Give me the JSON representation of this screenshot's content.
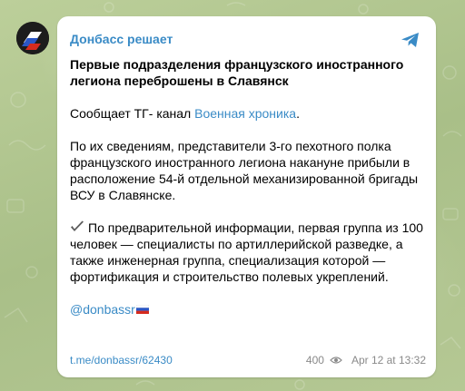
{
  "channel": {
    "name": "Донбасс решает"
  },
  "post": {
    "headline": "Первые подразделения французского иностранного легиона переброшены в Славянск",
    "source_prefix": "Сообщает ТГ- канал ",
    "source_link": "Военная хроника",
    "source_suffix": ".",
    "paragraph_2": "По их сведениям, представители 3-го пехотного полка французского иностранного легиона накануне прибыли в расположение 54-й отдельной механизированной бригады ВСУ в Славянске.",
    "paragraph_3": "По предварительной информации, первая группа из 100 человек — специалисты по артиллерийской разведке, а также инженерная группа, специализация которой — фортификация и строительство полевых укреплений.",
    "mention": "@donbassr",
    "flag_icon": "russia-flag-icon",
    "check_icon": "check-mark-icon"
  },
  "footer": {
    "post_link": "t.me/donbassr/62430",
    "views": "400",
    "views_icon": "eye-icon",
    "date": "Apr 12 at 13:32"
  },
  "colors": {
    "accent": "#3a8bc6",
    "meta": "#8a8a8a",
    "background": "#b2c691"
  }
}
